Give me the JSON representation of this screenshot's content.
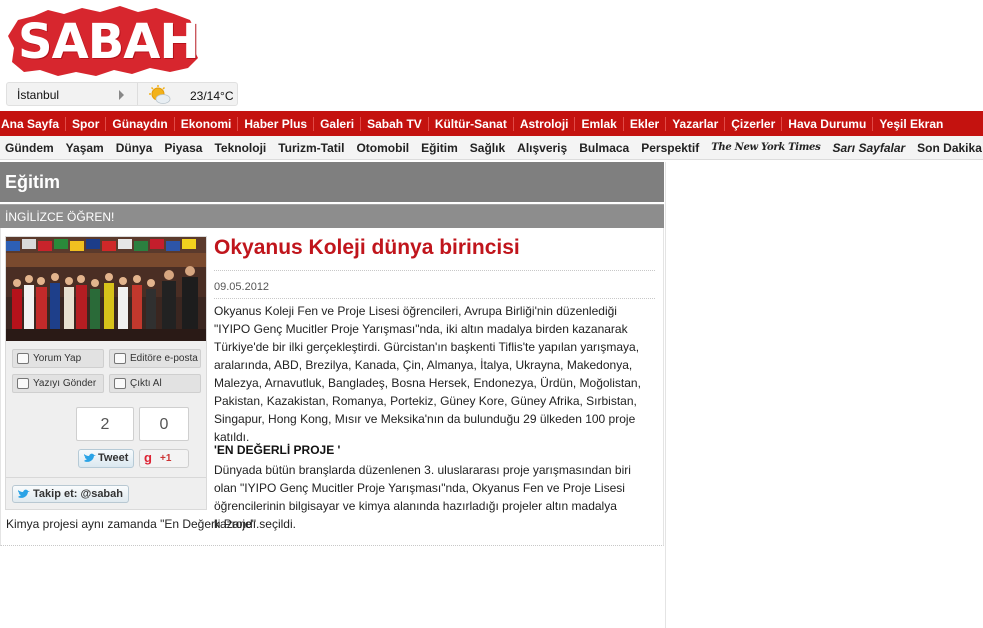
{
  "brand": {
    "logo_text": "SABAH",
    "logo_color": "#d7262e"
  },
  "weather": {
    "city": "İstanbul",
    "temperature": "23/14°C"
  },
  "main_nav": [
    "Ana Sayfa",
    "Spor",
    "Günaydın",
    "Ekonomi",
    "Haber Plus",
    "Galeri",
    "Sabah TV",
    "Kültür-Sanat",
    "Astroloji",
    "Emlak",
    "Ekler",
    "Yazarlar",
    "Çizerler",
    "Hava Durumu",
    "Yeşil Ekran"
  ],
  "sub_nav": [
    "Gündem",
    "Yaşam",
    "Dünya",
    "Piyasa",
    "Teknoloji",
    "Turizm-Tatil",
    "Otomobil",
    "Eğitim",
    "Sağlık",
    "Alışveriş",
    "Bulmaca",
    "Perspektif",
    "The New York Times",
    "Sarı Sayfalar",
    "Son Dakika"
  ],
  "section": {
    "title": "Eğitim",
    "subtitle": "İNGİLİZCE ÖĞREN!"
  },
  "actions": {
    "comment": "Yorum Yap",
    "email_editor": "Editöre e-posta",
    "send_article": "Yazıyı Gönder",
    "print": "Çıktı Al"
  },
  "social": {
    "tweet_count": "2",
    "gplus_count": "0",
    "tweet_label": "Tweet",
    "gplus_label": "+1",
    "follow_label": "Takip et: @sabah"
  },
  "article": {
    "headline": "Okyanus Koleji dünya birincisi",
    "date": "09.05.2012",
    "para1": "Okyanus Koleji Fen ve Proje Lisesi öğrencileri, Avrupa Birliği'nin düzenlediği \"IYIPO Genç Mucitler Proje Yarışması\"nda, iki altın madalya birden kazanarak Türkiye'de bir ilki gerçekleştirdi. Gürcistan'ın başkenti Tiflis'te yapılan yarışmaya, aralarında, ABD, Brezilya, Kanada, Çin, Almanya, İtalya, Ukrayna, Makedonya, Malezya, Arnavutluk, Bangladeş, Bosna Hersek, Endonezya, Ürdün, Moğolistan, Pakistan, Kazakistan, Romanya, Portekiz, Güney Kore, Güney Afrika, Sırbistan, Singapur, Hong Kong, Mısır ve Meksika'nın da bulunduğu 29 ülkeden 100 proje katıldı.",
    "subhead": "'EN DEĞERLİ PROJE '",
    "para2": "Dünyada bütün branşlarda düzenlenen 3. uluslararası proje yarışmasından biri olan \"IYIPO Genç Mucitler Proje Yarışması\"nda, Okyanus Fen ve Proje Lisesi öğrencilerinin bilgisayar ve kimya alanında hazırladığı projeler altın madalya kazandı.",
    "para3": "Kimya projesi aynı zamanda \"En Değerli Proje\" seçildi."
  }
}
